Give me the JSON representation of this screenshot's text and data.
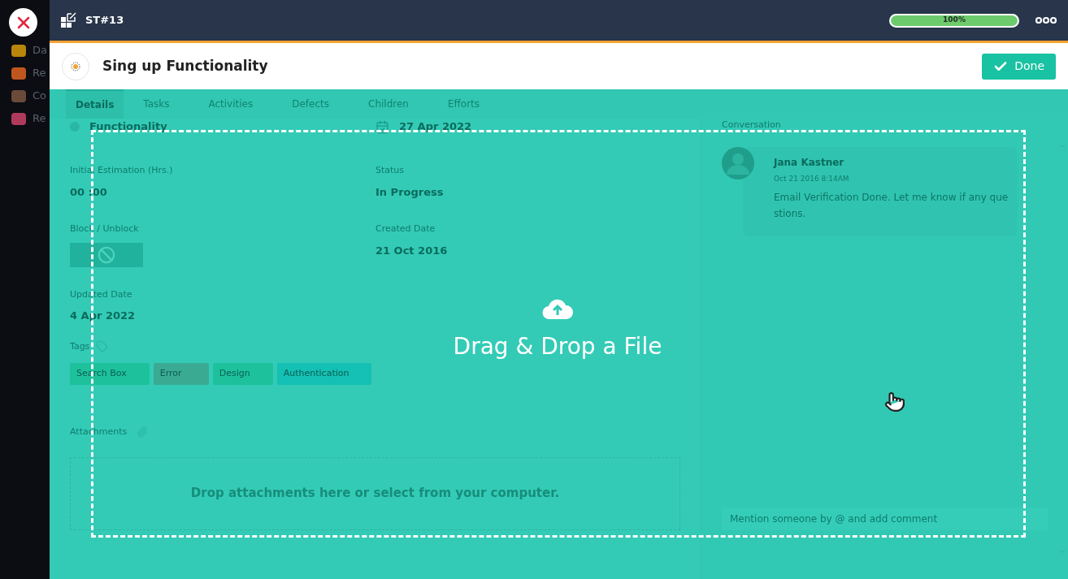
{
  "sidebar": {
    "items": [
      {
        "label": "Da",
        "color": "#b8860b"
      },
      {
        "label": "Re",
        "color": "#c0561f"
      },
      {
        "label": "Co",
        "color": "#6b4a3a"
      },
      {
        "label": "Re",
        "color": "#b03a5b"
      }
    ]
  },
  "topbar": {
    "ticket_id": "ST#13",
    "progress": {
      "level": 1,
      "reading": "100%"
    }
  },
  "task": {
    "title": "Sing up Functionality",
    "done_button": "Done"
  },
  "tabs": [
    {
      "label": "Details",
      "selected": true
    },
    {
      "label": "Tasks",
      "selected": false
    },
    {
      "label": "Activities",
      "selected": false
    },
    {
      "label": "Defects",
      "selected": false
    },
    {
      "label": "Children",
      "selected": false
    },
    {
      "label": "Efforts",
      "selected": false
    }
  ],
  "details": {
    "category": "Functionality",
    "due_date": "27 Apr 2022",
    "estimation": {
      "label": "Initial Estimation (Hrs.)",
      "value": "00 :00"
    },
    "status": {
      "label": "Status",
      "value": "In Progress"
    },
    "block": {
      "label": "Block / Unblock"
    },
    "created": {
      "label": "Created Date",
      "value": "21 Oct 2016"
    },
    "updated": {
      "label": "Updated Date",
      "value": "4 Apr 2022"
    },
    "tags": {
      "label": "Tags",
      "items": [
        {
          "label": "Search Box",
          "color": "#1dc29c"
        },
        {
          "label": "Error",
          "color": "#3aaa93"
        },
        {
          "label": "Design",
          "color": "#1dc29c"
        },
        {
          "label": "Authentication",
          "color": "#15c0b4"
        }
      ]
    },
    "attachments": {
      "label": "Attachments",
      "drop_text": "Drop attachments here or select from your computer."
    }
  },
  "conversation": {
    "title": "Conversation",
    "comments": [
      {
        "author": "Jana Kastner",
        "time": "Oct 21 2016 8:14AM",
        "text": "Email Verification Done. Let me know if any questions."
      }
    ],
    "placeholder": "Mention someone by @ and add comment"
  },
  "drop_overlay": {
    "text": "Drag & Drop a File"
  }
}
